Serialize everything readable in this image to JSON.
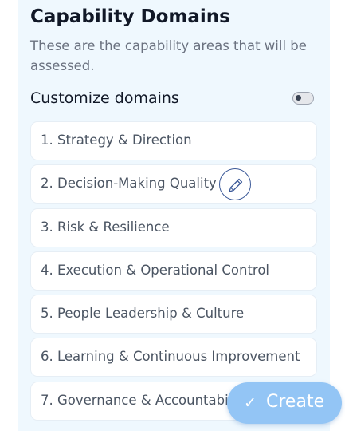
{
  "section": {
    "title": "Capability Domains",
    "subtitle": "These are the capability areas that will be assessed."
  },
  "customize": {
    "label": "Customize domains",
    "toggle_on": false
  },
  "domains": [
    {
      "label": "1. Strategy & Direction"
    },
    {
      "label": "2. Decision-Making Quality"
    },
    {
      "label": "3. Risk & Resilience"
    },
    {
      "label": "4. Execution & Operational Control"
    },
    {
      "label": "5. People Leadership & Culture"
    },
    {
      "label": "6. Learning & Continuous Improvement"
    },
    {
      "label": "7. Governance & Accountabi"
    }
  ],
  "icons": {
    "edit": "pencil-icon",
    "create": "check-icon"
  },
  "create_button": {
    "check": "✓",
    "label": "Create"
  },
  "colors": {
    "panel_background": "#eff8fe",
    "create_button": "#93c5f5",
    "edit_ring": "#3b5998"
  }
}
